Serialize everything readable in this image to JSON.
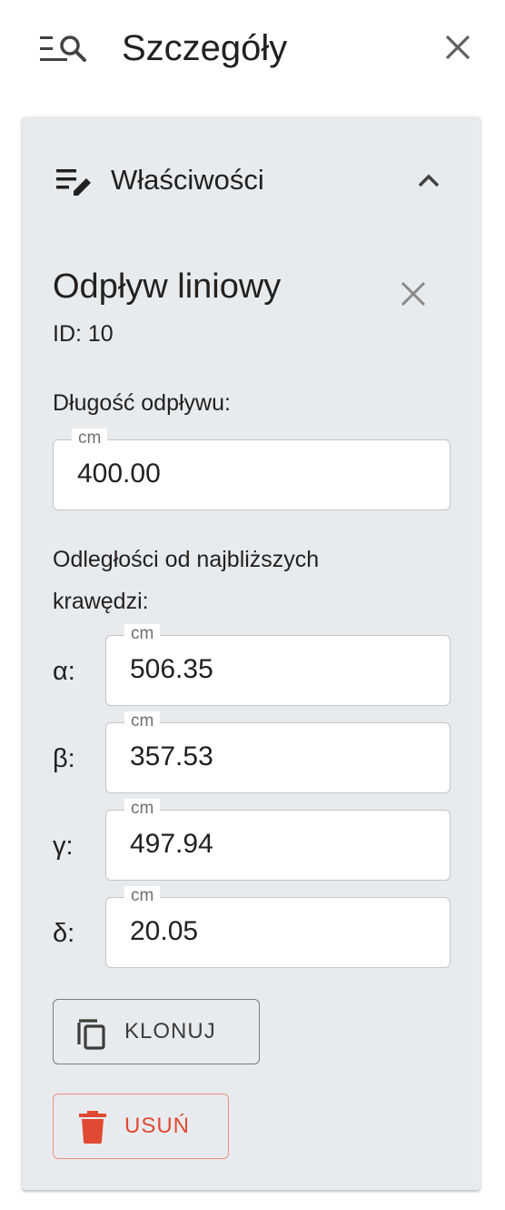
{
  "header": {
    "title": "Szczegóły",
    "icon": "details-search-icon",
    "close_icon": "close-icon"
  },
  "section": {
    "title": "Właściwości",
    "icon": "edit-list-icon",
    "chevron_icon": "chevron-up-icon",
    "expanded": true
  },
  "item": {
    "title": "Odpływ liniowy",
    "id_label": "ID:",
    "id_value": "10"
  },
  "drain_length": {
    "label": "Długość odpływu:",
    "unit": "cm",
    "value": "400.00"
  },
  "distances": {
    "label": "Odległości od najbliższych krawędzi:",
    "fields": [
      {
        "symbol": "α:",
        "unit": "cm",
        "value": "506.35"
      },
      {
        "symbol": "β:",
        "unit": "cm",
        "value": "357.53"
      },
      {
        "symbol": "γ:",
        "unit": "cm",
        "value": "497.94"
      },
      {
        "symbol": "δ:",
        "unit": "cm",
        "value": "20.05"
      }
    ]
  },
  "actions": {
    "clone_label": "KLONUJ",
    "clone_icon": "copy-icon",
    "delete_label": "USUŃ",
    "delete_icon": "trash-icon"
  },
  "colors": {
    "card_background": "#e8ebee",
    "delete_accent": "#e04a32",
    "delete_border": "#ef8f82",
    "field_border": "#c4c6c9"
  }
}
